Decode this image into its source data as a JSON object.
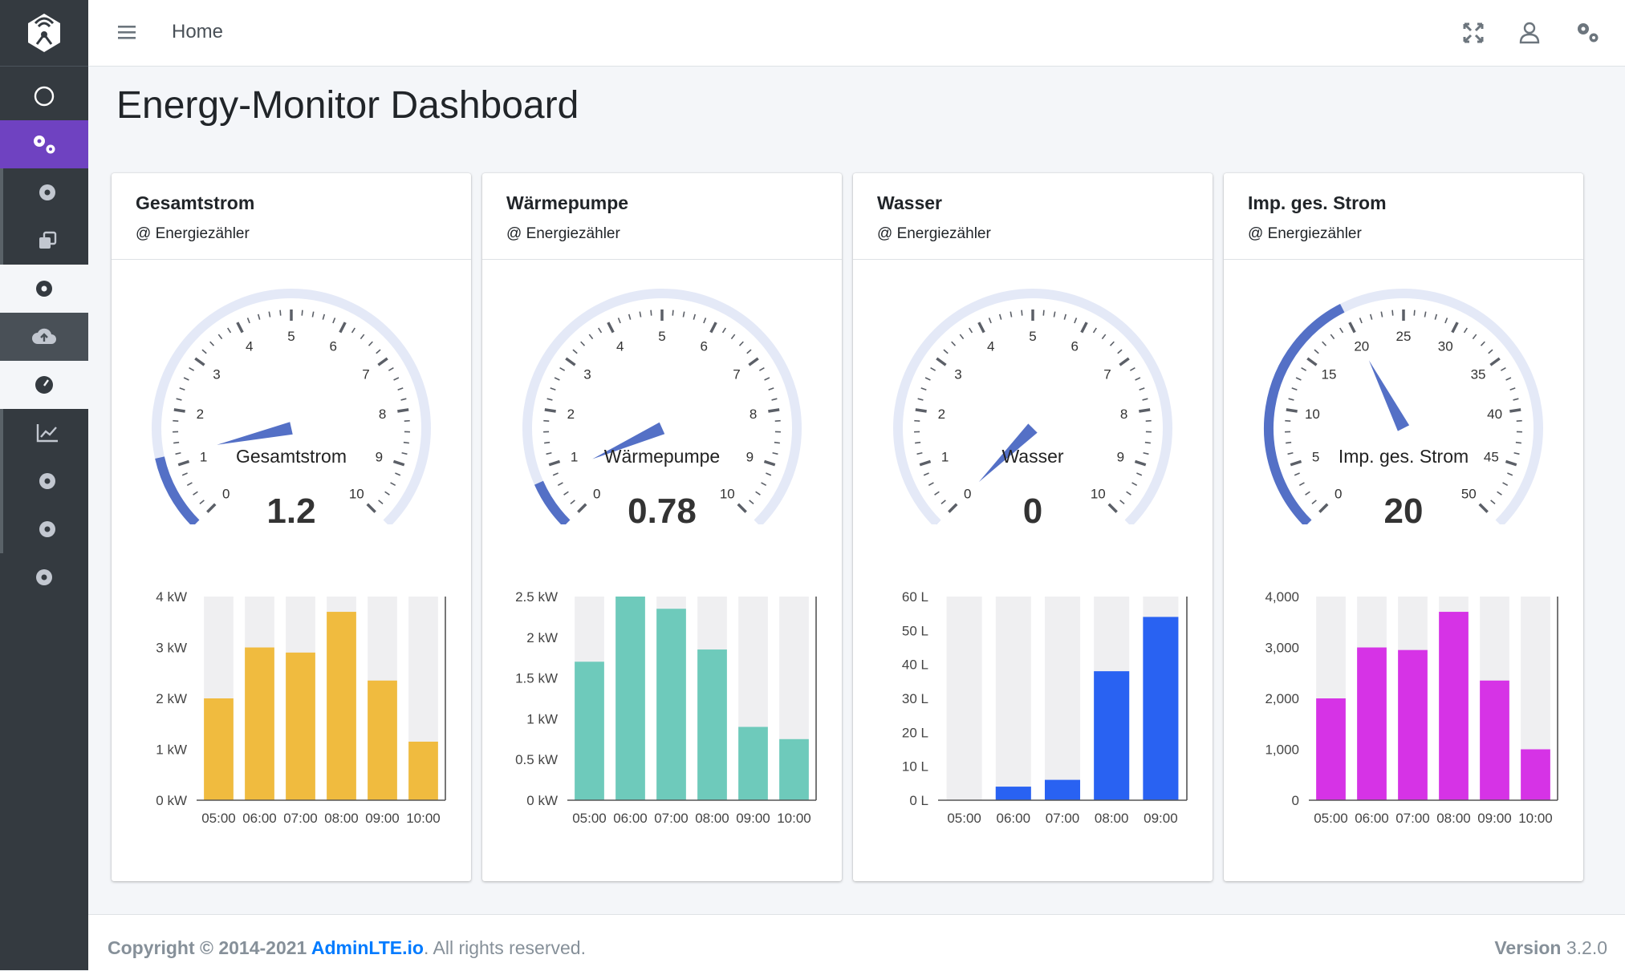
{
  "navbar": {
    "home_label": "Home",
    "icons": [
      "menu-icon",
      "fullscreen-icon",
      "user-icon",
      "gears-icon"
    ]
  },
  "sidebar": {
    "icons": [
      "logo-icon",
      "circle-icon",
      "gears-icon",
      "gear-icon",
      "copy-icon",
      "gear-icon",
      "cloud-upload-icon",
      "tachometer-icon",
      "chart-line-icon",
      "gear-icon",
      "gear-icon",
      "gear-icon"
    ],
    "active_color": "#6f42c1"
  },
  "page": {
    "title": "Energy-Monitor Dashboard"
  },
  "cards": [
    {
      "title": "Gesamtstrom",
      "subtitle": "@ Energiezähler",
      "gauge": {
        "label": "Gesamtstrom",
        "value_text": "1.2",
        "value": 1.2,
        "min": 0,
        "max": 10,
        "ticks": [
          "0",
          "1",
          "2",
          "3",
          "4",
          "5",
          "6",
          "7",
          "8",
          "9",
          "10"
        ],
        "minor_per_major": 4
      },
      "chart_data": {
        "type": "bar",
        "categories": [
          "05:00",
          "06:00",
          "07:00",
          "08:00",
          "09:00",
          "10:00"
        ],
        "values": [
          2.0,
          3.0,
          2.9,
          3.7,
          2.35,
          1.15
        ],
        "ylim": [
          0,
          4
        ],
        "yticks": [
          "0 kW",
          "1 kW",
          "2 kW",
          "3 kW",
          "4 kW"
        ],
        "ytick_values": [
          0,
          1,
          2,
          3,
          4
        ],
        "color": "#f0bb3f"
      }
    },
    {
      "title": "Wärmepumpe",
      "subtitle": "@ Energiezähler",
      "gauge": {
        "label": "Wärmepumpe",
        "value_text": "0.78",
        "value": 0.78,
        "min": 0,
        "max": 10,
        "ticks": [
          "0",
          "1",
          "2",
          "3",
          "4",
          "5",
          "6",
          "7",
          "8",
          "9",
          "10"
        ],
        "minor_per_major": 4
      },
      "chart_data": {
        "type": "bar",
        "categories": [
          "05:00",
          "06:00",
          "07:00",
          "08:00",
          "09:00",
          "10:00"
        ],
        "values": [
          1.7,
          2.5,
          2.35,
          1.85,
          0.9,
          0.75
        ],
        "ylim": [
          0,
          2.5
        ],
        "yticks": [
          "0 kW",
          "0.5 kW",
          "1 kW",
          "1.5 kW",
          "2 kW",
          "2.5 kW"
        ],
        "ytick_values": [
          0,
          0.5,
          1,
          1.5,
          2,
          2.5
        ],
        "color": "#6ecabb"
      }
    },
    {
      "title": "Wasser",
      "subtitle": "@ Energiezähler",
      "gauge": {
        "label": "Wasser",
        "value_text": "0",
        "value": 0,
        "min": 0,
        "max": 10,
        "ticks": [
          "0",
          "1",
          "2",
          "3",
          "4",
          "5",
          "6",
          "7",
          "8",
          "9",
          "10"
        ],
        "minor_per_major": 4
      },
      "chart_data": {
        "type": "bar",
        "categories": [
          "05:00",
          "06:00",
          "07:00",
          "08:00",
          "09:00"
        ],
        "values": [
          0,
          4,
          6,
          38,
          54
        ],
        "ylim": [
          0,
          60
        ],
        "yticks": [
          "0 L",
          "10 L",
          "20 L",
          "30 L",
          "40 L",
          "50 L",
          "60 L"
        ],
        "ytick_values": [
          0,
          10,
          20,
          30,
          40,
          50,
          60
        ],
        "color": "#2962f2"
      }
    },
    {
      "title": "Imp. ges. Strom",
      "subtitle": "@ Energiezähler",
      "gauge": {
        "label": "Imp. ges. Strom",
        "value_text": "20",
        "value": 20,
        "min": 0,
        "max": 50,
        "ticks": [
          "0",
          "5",
          "10",
          "15",
          "20",
          "25",
          "30",
          "35",
          "40",
          "45",
          "50"
        ],
        "minor_per_major": 4
      },
      "chart_data": {
        "type": "bar",
        "categories": [
          "05:00",
          "06:00",
          "07:00",
          "08:00",
          "09:00",
          "10:00"
        ],
        "values": [
          2000,
          3000,
          2950,
          3700,
          2350,
          1000
        ],
        "ylim": [
          0,
          4000
        ],
        "yticks": [
          "0",
          "1,000",
          "2,000",
          "3,000",
          "4,000"
        ],
        "ytick_values": [
          0,
          1000,
          2000,
          3000,
          4000
        ],
        "color": "#d633e6"
      }
    }
  ],
  "footer": {
    "copyright_prefix": "Copyright © 2014-2021 ",
    "brand_link": "AdminLTE.io",
    "copyright_suffix": ". All rights reserved.",
    "version_label": "Version",
    "version_number": "3.2.0"
  },
  "colors": {
    "gauge_arc_bg": "#e4e9f7",
    "gauge_arc_fill": "#5470c6",
    "needle": "#5470c6",
    "bar_bg": "#efeff1"
  }
}
